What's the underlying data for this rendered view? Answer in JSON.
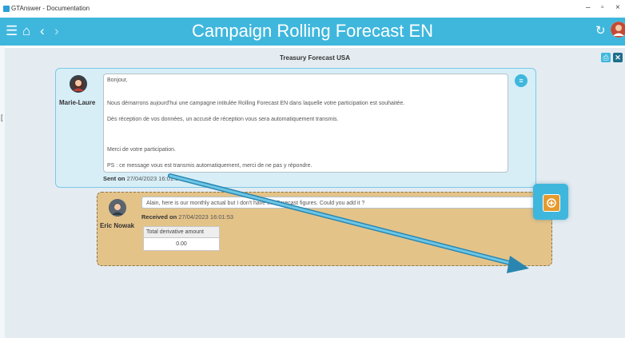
{
  "window": {
    "title": "GTAnswer - Documentation"
  },
  "header": {
    "title": "Campaign Rolling Forecast EN"
  },
  "section": {
    "title": "Treasury Forecast USA"
  },
  "message1": {
    "sender": "Marie-Laure",
    "lines": [
      "Bonjour,",
      "Nous démarrons aujourd'hui une campagne intitulée Rolling Forecast EN dans laquelle votre participation est souhaitée.",
      "Dès réception de vos données, un accusé de réception vous sera automatiquement transmis.",
      "Merci de votre participation.",
      "PS : ce message vous est transmis automatiquement, merci de ne pas y répondre."
    ],
    "sent_label": "Sent on",
    "sent_date": "27/04/2023 16:01:53"
  },
  "message2": {
    "sender": "Eric Nowak",
    "text": "Alain, here is our monthly actual but I don't have the Forecast figures. Could you add it ?",
    "received_label": "Received on",
    "received_date": "27/04/2023 16:01:53",
    "table": {
      "header": "Total derivative amount",
      "value": "0.00"
    }
  },
  "icons": {
    "menu": "hamburger-icon",
    "home": "home-icon",
    "back": "chevron-left-icon",
    "forward": "chevron-right-icon",
    "refresh": "refresh-icon",
    "user": "user-avatar-icon"
  },
  "colors": {
    "accent": "#3fb7dd",
    "card1_bg": "#d7eef7",
    "card2_bg": "#e4c389",
    "action": "#e69a2e"
  }
}
